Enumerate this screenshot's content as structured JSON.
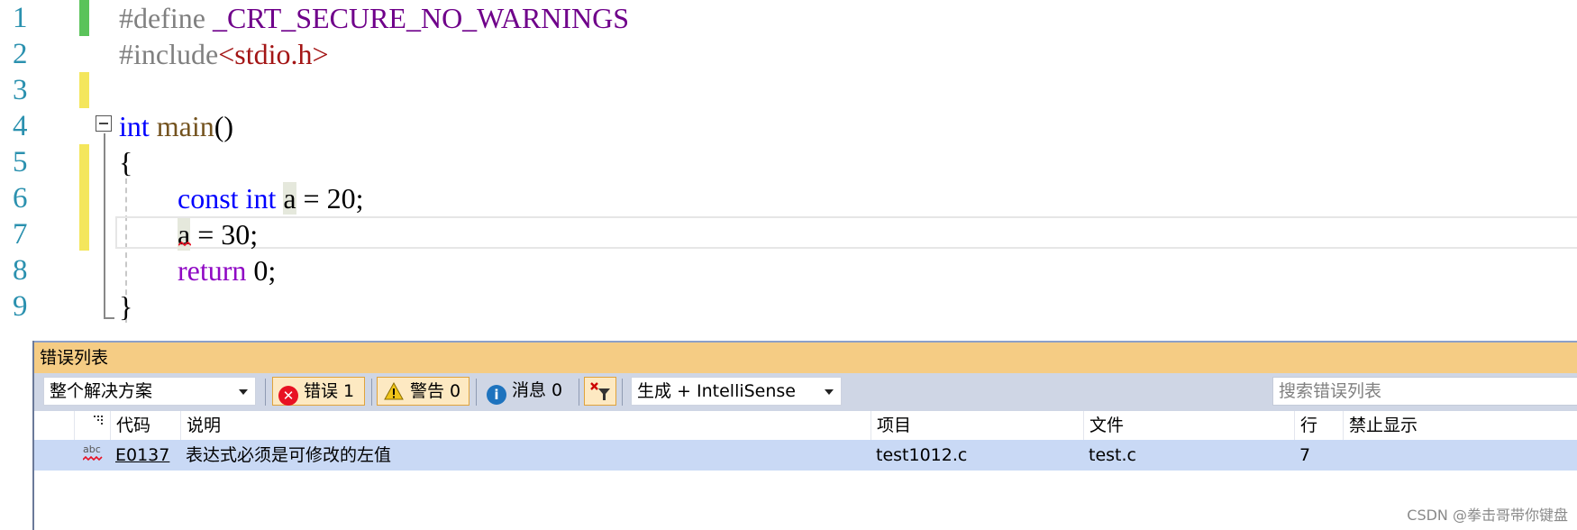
{
  "editor": {
    "line_numbers": [
      "1",
      "2",
      "3",
      "4",
      "5",
      "6",
      "7",
      "8",
      "9"
    ],
    "lines": {
      "l1_directive": "#define",
      "l1_macro": " _CRT_SECURE_NO_WARNINGS",
      "l2_directive": "#include",
      "l2_header": "<stdio.h>",
      "l4_type": "int",
      "l4_func": "main",
      "l4_paren": "()",
      "l5_brace": "{",
      "l6_const": "const",
      "l6_int": "int",
      "l6_var": "a",
      "l6_rest": " = 20;",
      "l7_var": "a",
      "l7_rest": " = 30;",
      "l8_return": "return",
      "l8_rest": " 0;",
      "l9_brace": "}"
    }
  },
  "error_list": {
    "title": "错误列表",
    "scope_dropdown": "整个解决方案",
    "errors_button": "错误 1",
    "warnings_button": "警告 0",
    "messages_button": "消息 0",
    "build_dropdown": "生成 + IntelliSense",
    "search_placeholder": "搜索错误列表",
    "columns": {
      "code": "代码",
      "description": "说明",
      "project": "项目",
      "file": "文件",
      "line": "行",
      "suppress": "禁止显示"
    },
    "row": {
      "type_icon": "abc",
      "code": "E0137",
      "description": "表达式必须是可修改的左值",
      "project": "test1012.c",
      "file": "test.c",
      "line": "7"
    }
  },
  "watermark": "CSDN @拳击哥带你键盘",
  "colors": {
    "change_green": "#5ac35a",
    "change_yellow": "#f4e65c",
    "panel_title": "#f5cc84",
    "error_red": "#e81123",
    "warning_yellow": "#f0c419",
    "info_blue": "#1e73be"
  }
}
